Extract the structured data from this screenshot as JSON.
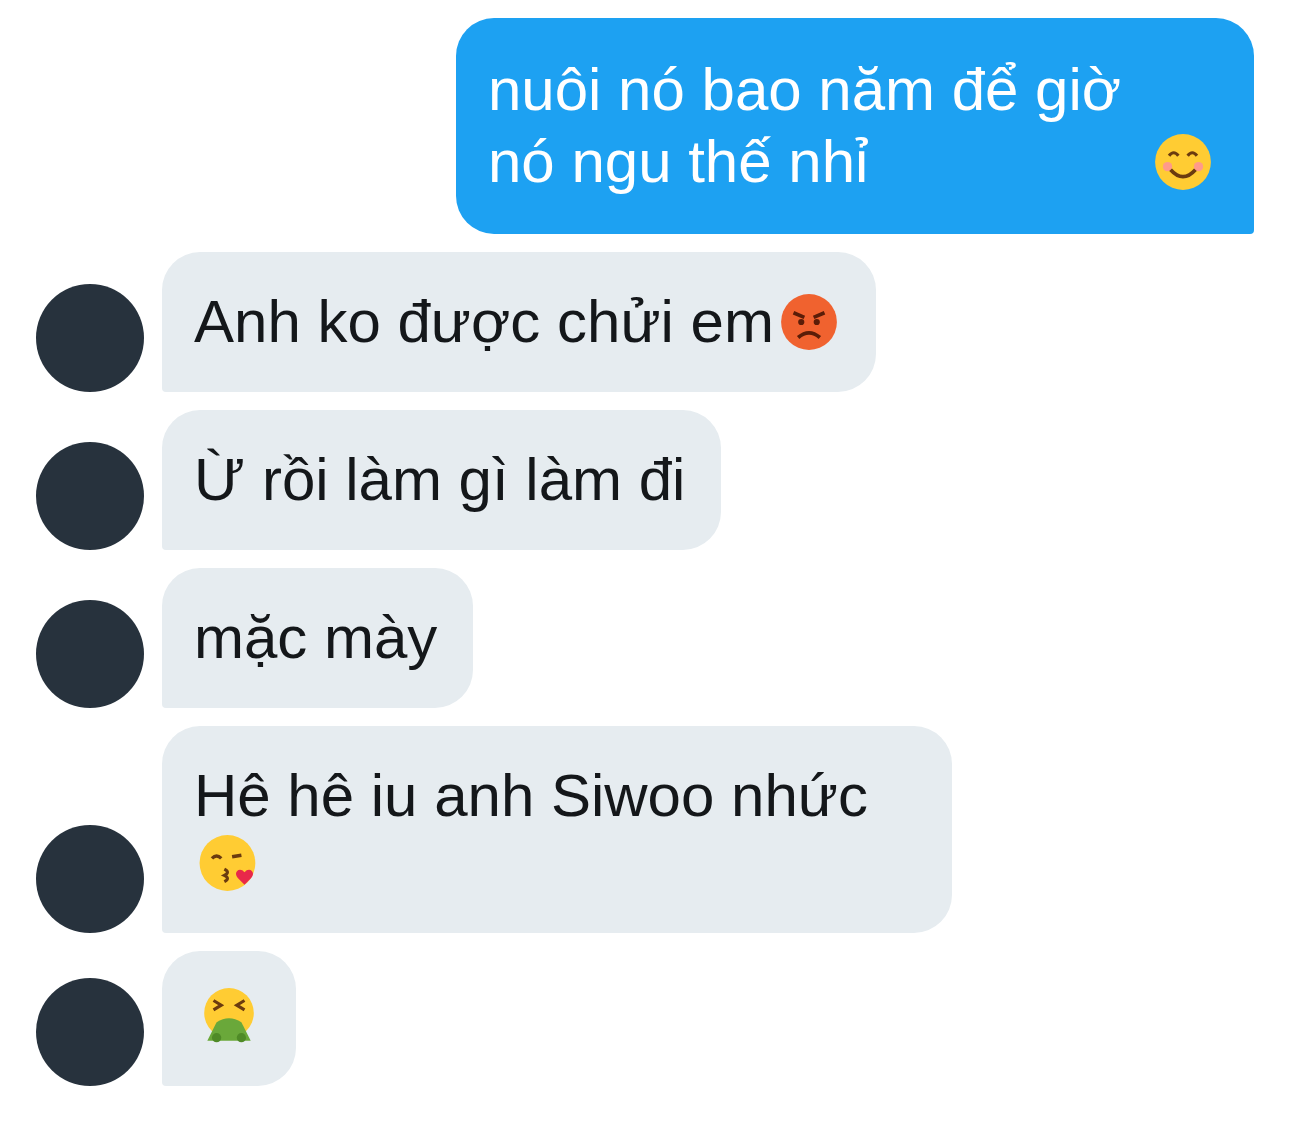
{
  "messages": [
    {
      "kind": "sent",
      "text": "nuôi nó bao năm để giờ nó ngu thế nhỉ",
      "emoji": {
        "kind": "smile"
      }
    },
    {
      "kind": "received",
      "text": "Anh ko được chửi em",
      "emoji": {
        "kind": "angry"
      }
    },
    {
      "kind": "received",
      "text": "Ừ rồi làm gì làm đi"
    },
    {
      "kind": "received",
      "text": "mặc mày"
    },
    {
      "kind": "received",
      "text": "Hê hê iu anh Siwoo nhức",
      "emoji": {
        "kind": "kiss"
      }
    },
    {
      "kind": "received",
      "emoji": {
        "kind": "vomit"
      }
    }
  ]
}
